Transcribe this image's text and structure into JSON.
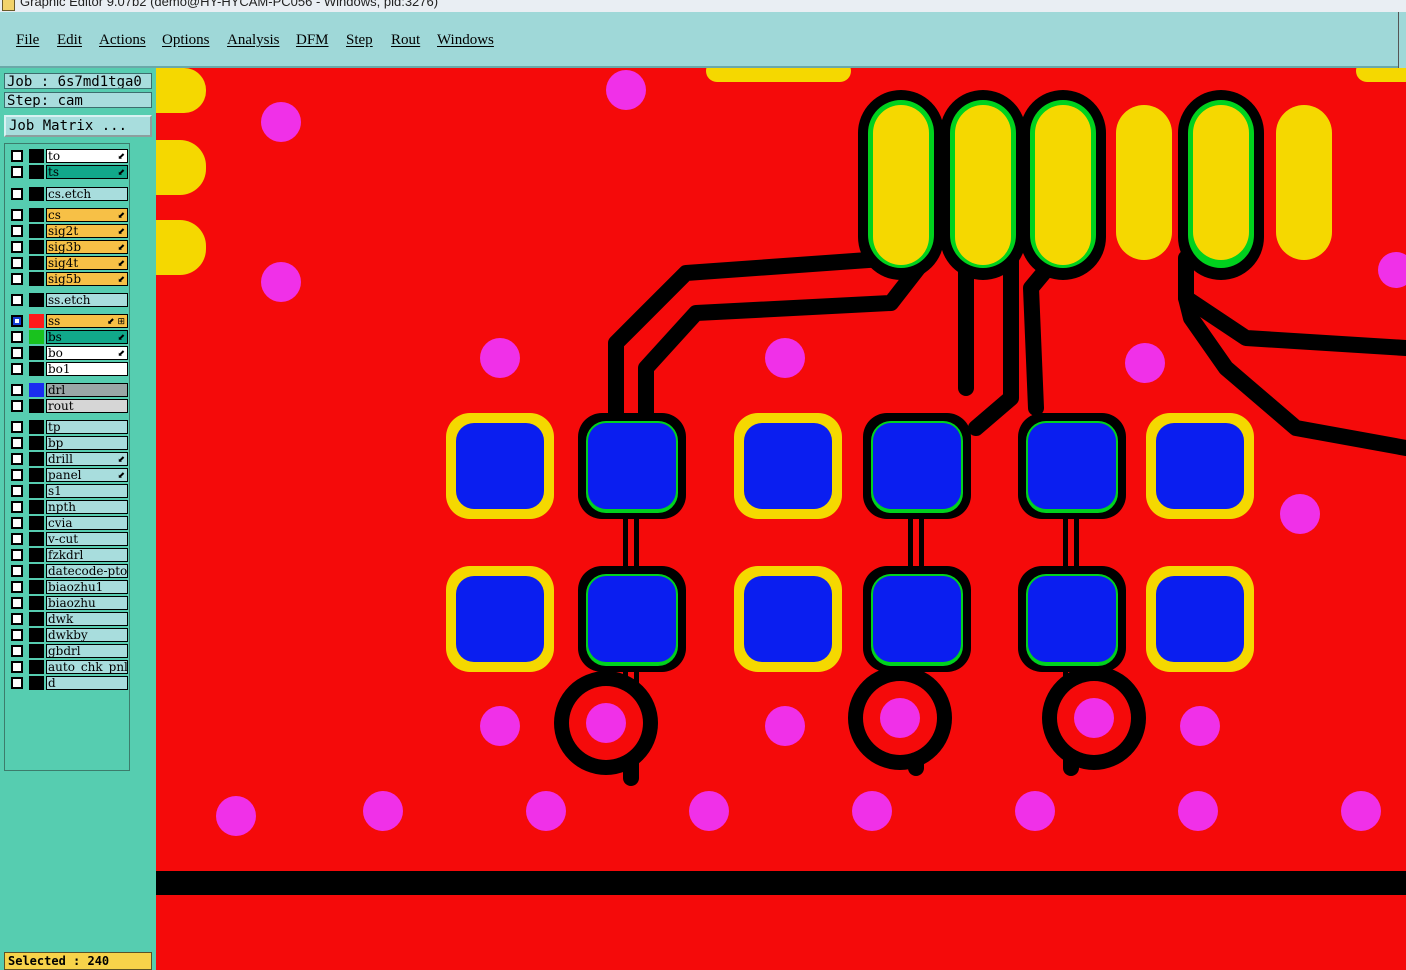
{
  "window": {
    "title": "Graphic Editor 9.07b2 (demo@HY-HYCAM-PC056 - Windows, pid:3276)"
  },
  "menu": {
    "items": [
      "File",
      "Edit",
      "Actions",
      "Options",
      "Analysis",
      "DFM",
      "Step",
      "Rout",
      "Windows"
    ]
  },
  "panel": {
    "job": "Job : 6s7md1tga0",
    "step": "Step: cam",
    "job_matrix": "Job Matrix ...",
    "layers": [
      {
        "name": "to",
        "bg": "#ffffff",
        "flag": "⬋"
      },
      {
        "name": "ts",
        "bg": "#11a88a",
        "flag": "⬋"
      },
      {
        "name": "cs.etch",
        "bg": "#a8dddd",
        "flag": ""
      },
      {
        "name": "cs",
        "bg": "#f7c046",
        "flag": "⬋"
      },
      {
        "name": "sig2t",
        "bg": "#f7c046",
        "flag": "⬋"
      },
      {
        "name": "sig3b",
        "bg": "#f7c046",
        "flag": "⬋"
      },
      {
        "name": "sig4t",
        "bg": "#f7c046",
        "flag": "⬋"
      },
      {
        "name": "sig5b",
        "bg": "#f7c046",
        "flag": "⬋"
      },
      {
        "name": "ss.etch",
        "bg": "#a8dddd",
        "flag": ""
      },
      {
        "name": "ss",
        "bg": "#f7c046",
        "flag": "⬋ ⊞"
      },
      {
        "name": "bs",
        "bg": "#11a88a",
        "flag": "⬋"
      },
      {
        "name": "bo",
        "bg": "#ffffff",
        "flag": "⬋"
      },
      {
        "name": "bo1",
        "bg": "#ffffff",
        "flag": ""
      },
      {
        "name": "drl",
        "bg": "#9aa6a6",
        "flag": ""
      },
      {
        "name": "rout",
        "bg": "#d6d6d6",
        "flag": ""
      },
      {
        "name": "tp",
        "bg": "#a8dddd",
        "flag": ""
      },
      {
        "name": "bp",
        "bg": "#a8dddd",
        "flag": ""
      },
      {
        "name": "drill",
        "bg": "#a8dddd",
        "flag": "⬋"
      },
      {
        "name": "panel",
        "bg": "#a8dddd",
        "flag": "⬋"
      },
      {
        "name": "s1",
        "bg": "#a8dddd",
        "flag": ""
      },
      {
        "name": "npth",
        "bg": "#a8dddd",
        "flag": ""
      },
      {
        "name": "cvia",
        "bg": "#a8dddd",
        "flag": ""
      },
      {
        "name": "v-cut",
        "bg": "#a8dddd",
        "flag": ""
      },
      {
        "name": "fzkdrl",
        "bg": "#a8dddd",
        "flag": ""
      },
      {
        "name": "datecode-pto",
        "bg": "#a8dddd",
        "flag": ""
      },
      {
        "name": "biaozhu1",
        "bg": "#a8dddd",
        "flag": ""
      },
      {
        "name": "biaozhu",
        "bg": "#a8dddd",
        "flag": ""
      },
      {
        "name": "dwk",
        "bg": "#a8dddd",
        "flag": ""
      },
      {
        "name": "dwkby",
        "bg": "#a8dddd",
        "flag": ""
      },
      {
        "name": "gbdrl",
        "bg": "#a8dddd",
        "flag": ""
      },
      {
        "name": "auto_chk_pnl",
        "bg": "#a8dddd",
        "flag": ""
      },
      {
        "name": "d",
        "bg": "#a8dddd",
        "flag": ""
      }
    ],
    "status": "Selected : 240"
  },
  "colors": {
    "copper": "#f50a0a",
    "trace": "#000000",
    "pad_yellow": "#f5d800",
    "pad_green": "#00d21e",
    "pad_blue": "#0a1ef0",
    "via_magenta": "#f030e8"
  }
}
